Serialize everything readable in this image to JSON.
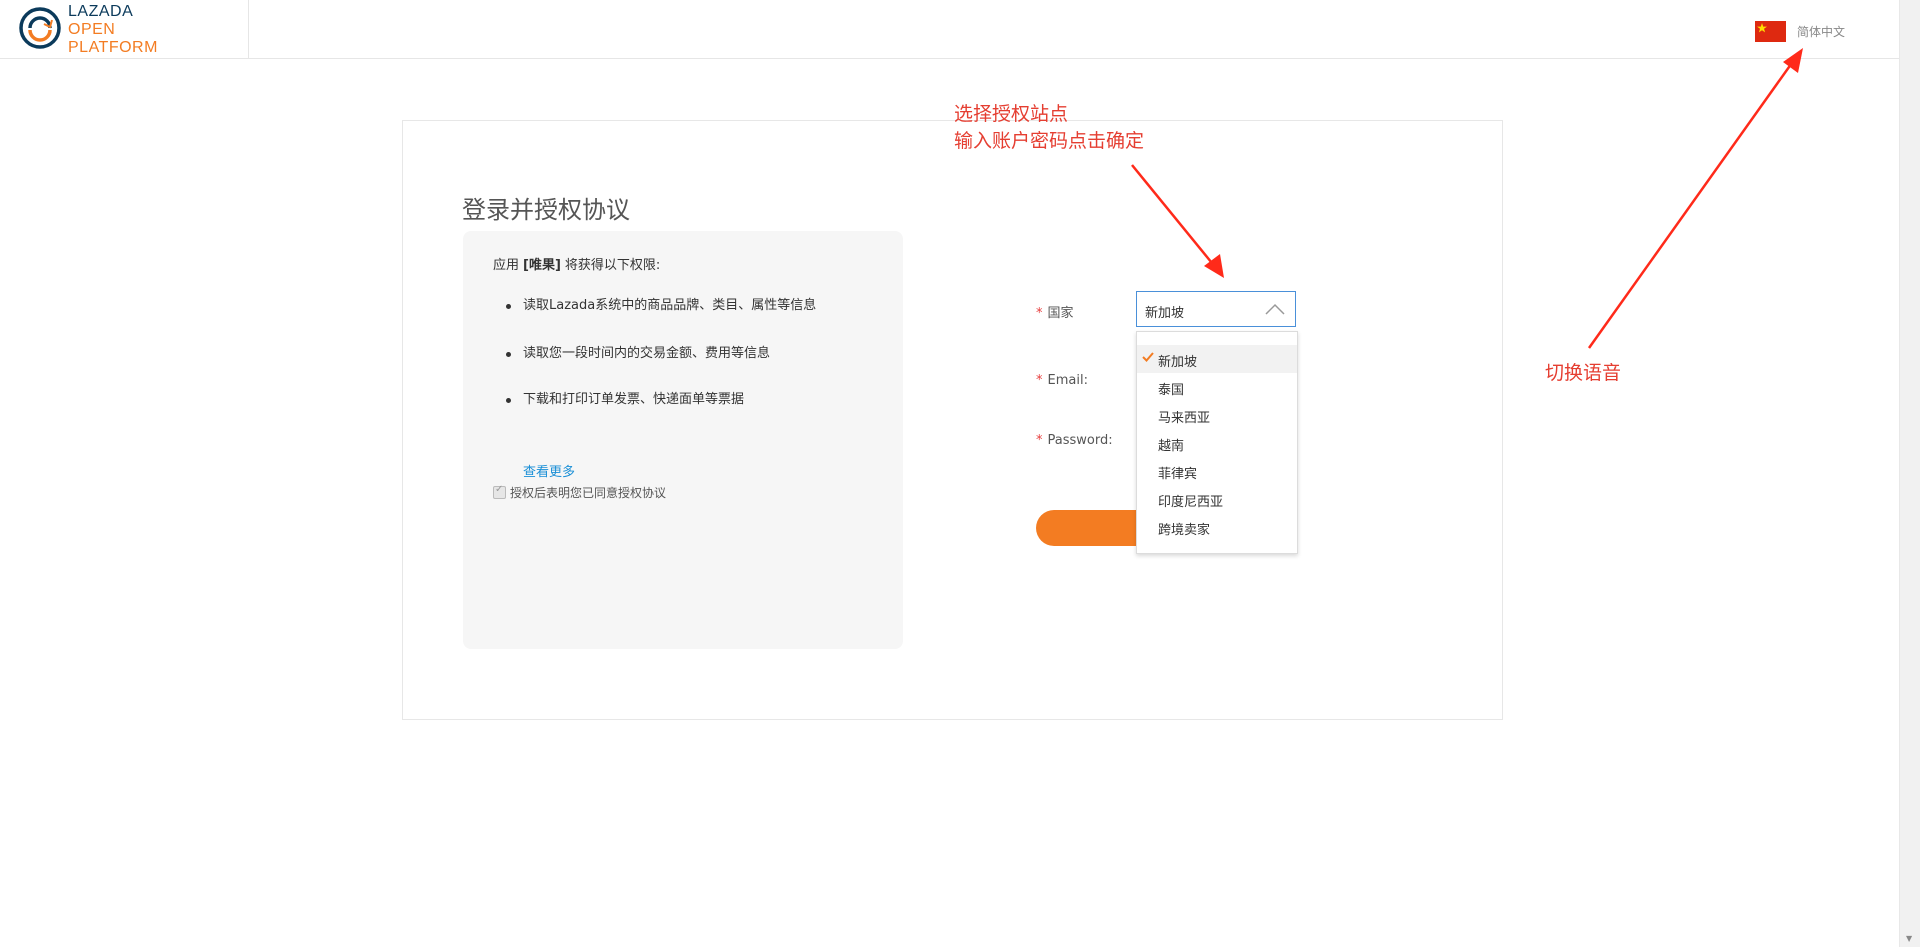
{
  "header": {
    "logo": {
      "line1": "LAZADA",
      "line2": "OPEN",
      "line3": "PLATFORM"
    },
    "language_label": "简体中文"
  },
  "page": {
    "title": "登录并授权协议"
  },
  "permissions": {
    "intro_prefix": "应用",
    "app_name": "[唯果]",
    "intro_suffix": "将获得以下权限:",
    "items": [
      "读取Lazada系统中的商品品牌、类目、属性等信息",
      "读取您一段时间内的交易金额、费用等信息",
      "下载和打印订单发票、快递面单等票据"
    ],
    "see_more": "查看更多",
    "agree_text": "授权后表明您已同意授权协议"
  },
  "form": {
    "required_mark": "*",
    "country_label": "国家",
    "country_value": "新加坡",
    "email_label": "Email:",
    "password_label": "Password:"
  },
  "dropdown": {
    "options": [
      "新加坡",
      "泰国",
      "马来西亚",
      "越南",
      "菲律宾",
      "印度尼西亚",
      "跨境卖家"
    ],
    "selected": "新加坡"
  },
  "annotations": {
    "top_line1": "选择授权站点",
    "top_line2": "输入账户密码点击确定",
    "right": "切换语音"
  },
  "colors": {
    "accent_orange": "#f37c22",
    "link_blue": "#1a8fd6",
    "annotation_red": "#e53e31",
    "logo_navy": "#0b3a5b"
  },
  "icons": [
    "lazada-logo-icon",
    "china-flag-icon",
    "chevron-up-icon",
    "check-icon"
  ]
}
